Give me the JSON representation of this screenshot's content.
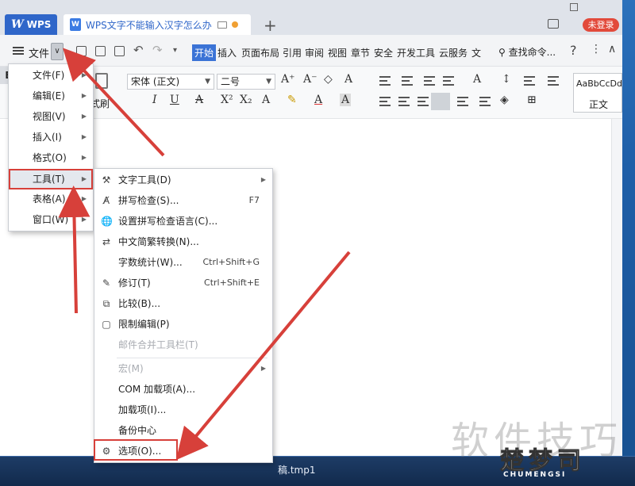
{
  "window": {
    "app_tab": "WPS",
    "doc_tab_title": "WPS文字不能输入汉字怎么办",
    "login_button": "未登录"
  },
  "ribbon": {
    "file_label": "文件",
    "tabs": [
      "开始",
      "插入",
      "页面布局",
      "引用",
      "审阅",
      "视图",
      "章节",
      "安全",
      "开发工具",
      "云服务",
      "文"
    ],
    "search_label": "查找命令..."
  },
  "toolbar": {
    "font_name": "宋体 (正文)",
    "font_size": "二号",
    "cut_label": "式刷",
    "styles_sample": "AaBbCcDd",
    "styles_normal": "正文"
  },
  "file_menu": {
    "items": [
      {
        "label": "文件(F)"
      },
      {
        "label": "编辑(E)"
      },
      {
        "label": "视图(V)"
      },
      {
        "label": "插入(I)"
      },
      {
        "label": "格式(O)"
      },
      {
        "label": "工具(T)"
      },
      {
        "label": "表格(A)"
      },
      {
        "label": "窗口(W)"
      }
    ]
  },
  "tools_menu": {
    "items": [
      {
        "label": "文字工具(D)",
        "icon": "wrench-icon",
        "shortcut": ""
      },
      {
        "label": "拼写检查(S)...",
        "icon": "spell-check-icon",
        "shortcut": "F7"
      },
      {
        "label": "设置拼写检查语言(C)...",
        "icon": "globe-icon",
        "shortcut": ""
      },
      {
        "label": "中文简繁转换(N)...",
        "icon": "convert-icon",
        "shortcut": ""
      },
      {
        "label": "字数统计(W)...",
        "icon": "",
        "shortcut": "Ctrl+Shift+G"
      },
      {
        "label": "修订(T)",
        "icon": "track-changes-icon",
        "shortcut": "Ctrl+Shift+E"
      },
      {
        "label": "比较(B)...",
        "icon": "compare-icon",
        "shortcut": ""
      },
      {
        "label": "限制编辑(P)",
        "icon": "restrict-edit-icon",
        "shortcut": ""
      },
      {
        "label": "邮件合并工具栏(T)",
        "icon": "",
        "shortcut": ""
      },
      {
        "label": "宏(M)",
        "icon": "",
        "shortcut": ""
      },
      {
        "label": "COM 加载项(A)...",
        "icon": "",
        "shortcut": ""
      },
      {
        "label": "加载项(I)...",
        "icon": "",
        "shortcut": ""
      },
      {
        "label": "备份中心",
        "icon": "",
        "shortcut": ""
      },
      {
        "label": "选项(O)...",
        "icon": "gear-icon",
        "shortcut": ""
      }
    ]
  },
  "taskbar": {
    "file_name": "稿.tmp1"
  },
  "watermark": {
    "text": "软件技巧",
    "logo_text": "楚梦司",
    "logo_sub": "CHUMENGSI"
  },
  "colors": {
    "accent": "#3b73d6",
    "highlight_red": "#d7403a",
    "login_red": "#e24a3b"
  }
}
